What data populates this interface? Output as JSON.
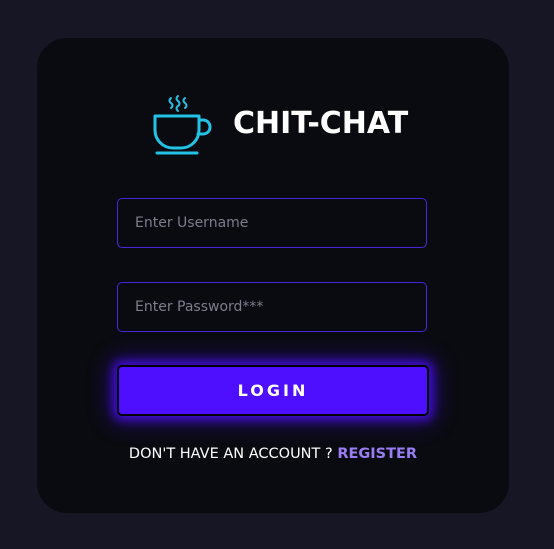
{
  "brand": {
    "title": "CHIT-CHAT",
    "icon": "coffee-cup-icon",
    "icon_color": "#22c3e6"
  },
  "form": {
    "username_placeholder": "Enter Username",
    "password_placeholder": "Enter Password***",
    "login_label": "LOGIN"
  },
  "footer": {
    "prompt": "DON'T HAVE AN ACCOUNT ? ",
    "register_label": "REGISTER"
  },
  "colors": {
    "background": "#171624",
    "card": "#0a0b10",
    "accent": "#4e0eff",
    "field_border": "#4a25d8",
    "link": "#9a7df5"
  }
}
